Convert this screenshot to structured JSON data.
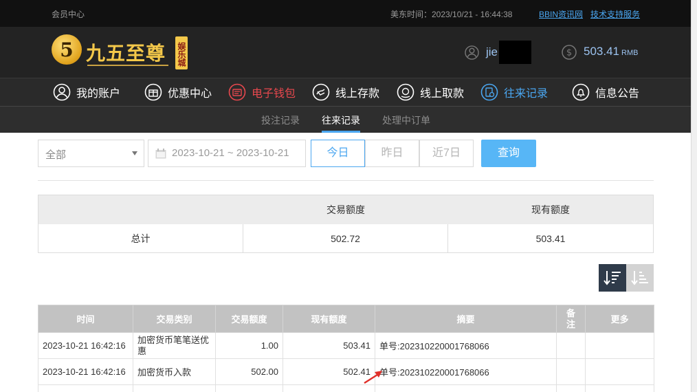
{
  "topbar": {
    "member_center": "会员中心",
    "time_label": "美东时间：2023/10/21 - 16:44:38",
    "link_news": "BBIN资讯网",
    "link_support": "技术支持服务"
  },
  "header": {
    "logo_text": "九五至尊",
    "logo_tag": "娱乐城",
    "username": "jie",
    "balance": "503.41",
    "currency": "RMB"
  },
  "nav": [
    {
      "label": "我的账户",
      "icon": "user-icon"
    },
    {
      "label": "优惠中心",
      "icon": "gift-icon"
    },
    {
      "label": "电子钱包",
      "icon": "wallet-icon",
      "color": "#e8484e"
    },
    {
      "label": "线上存款",
      "icon": "deposit-icon"
    },
    {
      "label": "线上取款",
      "icon": "withdraw-icon"
    },
    {
      "label": "往来记录",
      "icon": "records-icon",
      "color": "#4aa6f0"
    },
    {
      "label": "信息公告",
      "icon": "bell-icon"
    }
  ],
  "subnav": [
    "投注记录",
    "往来记录",
    "处理中订单"
  ],
  "filters": {
    "type_selected": "全部",
    "date_range": "2023-10-21 ~ 2023-10-21",
    "day_buttons": [
      "今日",
      "昨日",
      "近7日"
    ],
    "query": "查询"
  },
  "summary": {
    "col_amount": "交易额度",
    "col_balance": "现有额度",
    "row_label": "总计",
    "amount": "502.72",
    "balance": "503.41"
  },
  "table": {
    "headers": [
      "时间",
      "交易类别",
      "交易额度",
      "现有额度",
      "摘要",
      "备注",
      "更多"
    ],
    "rows": [
      {
        "time": "2023-10-21 16:42:16",
        "type": "加密货币笔笔送优惠",
        "amount": "1.00",
        "balance": "503.41",
        "summary": "单号:202310220001768066",
        "note": "",
        "more": ""
      },
      {
        "time": "2023-10-21 16:42:16",
        "type": "加密货币入款",
        "amount": "502.00",
        "balance": "502.41",
        "summary": "单号:202310220001768066",
        "note": "",
        "more": ""
      }
    ]
  },
  "colors": {
    "accent": "#4aa6f0",
    "wallet": "#e8484e",
    "query_btn": "#57b6f6",
    "sort_active": "#2f3b4a"
  }
}
